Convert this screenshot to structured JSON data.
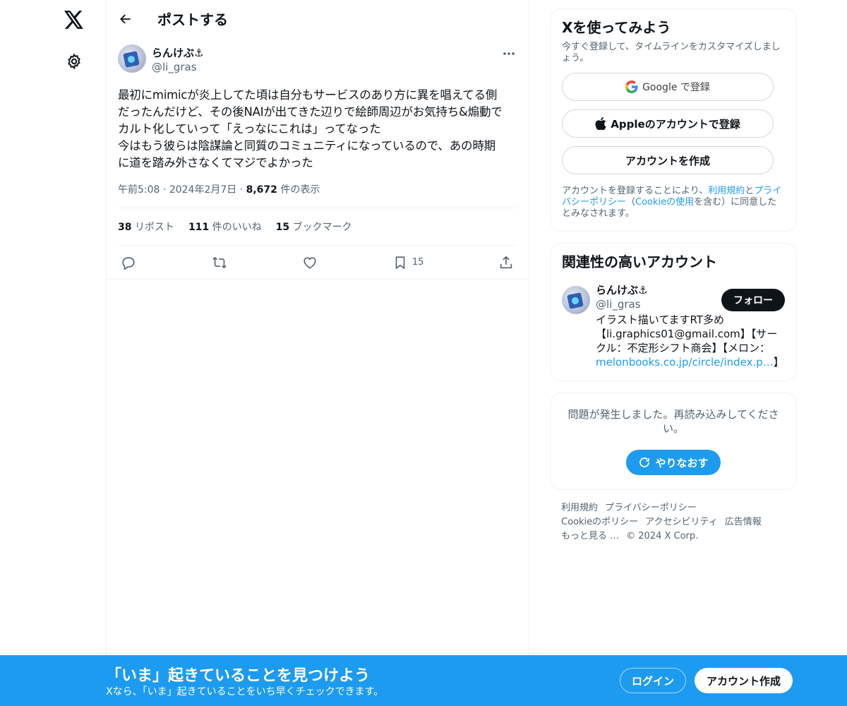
{
  "header": {
    "title": "ポストする"
  },
  "post": {
    "author_name": "らんけぶ⚓",
    "author_handle": "@li_gras",
    "text": "最初にmimicが炎上してた頃は自分もサービスのあり方に異を唱えてる側\nだったんだけど、その後NAIが出てきた辺りで絵師周辺がお気持ち&煽動で\nカルト化していって「えっなにこれは」ってなった\n今はもう彼らは陰謀論と同質のコミュニティになっているので、あの時期\nに道を踏み外さなくてマジでよかった",
    "time": "午前5:08",
    "date": "2024年2月7日",
    "views_count": "8,672",
    "views_label": "件の表示",
    "reposts_count": "38",
    "reposts_label": "リポスト",
    "likes_count": "111",
    "likes_label": "件のいいね",
    "bookmarks_count": "15",
    "bookmarks_label": "ブックマーク",
    "bookmark_action_count": "15"
  },
  "signup_card": {
    "title": "Xを使ってみよう",
    "subtitle": "今すぐ登録して、タイムラインをカスタマイズしましょう。",
    "google_label": "Google で登録",
    "apple_label": "Appleのアカウントで登録",
    "create_label": "アカウントを作成",
    "legal_pre": "アカウントを登録することにより、",
    "legal_terms": "利用規約",
    "legal_and": "と",
    "legal_privacy": "プライバシーポリシー",
    "legal_mid": "（",
    "legal_cookie": "Cookieの使用",
    "legal_post": "を含む）に同意したとみなされます。"
  },
  "related": {
    "title": "関連性の高いアカウント",
    "name": "らんけぶ⚓",
    "handle": "@li_gras",
    "follow_label": "フォロー",
    "bio_text": "イラスト描いてますRT多め【li.graphics01@gmail.com】【サークル：不定形シフト商会】【メロン：",
    "bio_link": "melonbooks.co.jp/circle/index.p…",
    "bio_end": "】"
  },
  "error_card": {
    "message": "問題が発生しました。再読み込みしてください。",
    "retry_label": "やりなおす"
  },
  "footer": {
    "terms": "利用規約",
    "privacy": "プライバシーポリシー",
    "cookie": "Cookieのポリシー",
    "accessibility": "アクセシビリティ",
    "ads": "広告情報",
    "more": "もっと見る …",
    "copyright": "© 2024 X Corp."
  },
  "banner": {
    "title": "「いま」起きていることを見つけよう",
    "subtitle": "Xなら、「いま」起きていることをいち早くチェックできます。",
    "login_label": "ログイン",
    "signup_label": "アカウント作成"
  },
  "colors": {
    "accent": "#1d9bf0",
    "text": "#0f1419",
    "muted": "#536471",
    "border": "#eff3f4"
  }
}
